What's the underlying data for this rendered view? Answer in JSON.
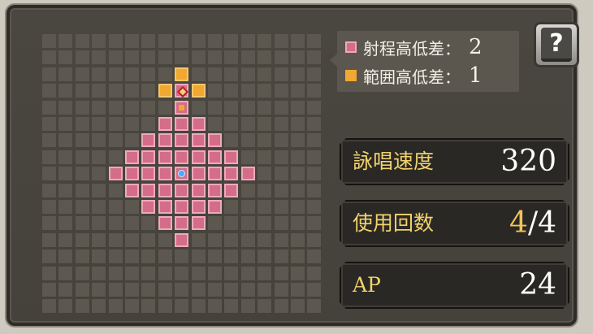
{
  "legend": {
    "range_label": "射程高低差：",
    "range_value": "2",
    "area_label": "範囲高低差：",
    "area_value": "1"
  },
  "help_icon": "help-book-icon",
  "stats": {
    "cast_speed": {
      "label": "詠唱速度",
      "value": "320"
    },
    "uses": {
      "label": "使用回数",
      "current": "4",
      "sep": "/",
      "max": "4"
    },
    "ap": {
      "label": "AP",
      "value": "24"
    }
  },
  "grid": {
    "cols": 17,
    "rows": 17,
    "origin": [
      8,
      8
    ],
    "range_cells": [
      [
        8,
        3
      ],
      [
        8,
        4
      ],
      [
        7,
        5
      ],
      [
        8,
        5
      ],
      [
        9,
        5
      ],
      [
        6,
        6
      ],
      [
        7,
        6
      ],
      [
        8,
        6
      ],
      [
        9,
        6
      ],
      [
        10,
        6
      ],
      [
        5,
        7
      ],
      [
        6,
        7
      ],
      [
        7,
        7
      ],
      [
        8,
        7
      ],
      [
        9,
        7
      ],
      [
        10,
        7
      ],
      [
        11,
        7
      ],
      [
        4,
        8
      ],
      [
        5,
        8
      ],
      [
        6,
        8
      ],
      [
        7,
        8
      ],
      [
        8,
        8
      ],
      [
        9,
        8
      ],
      [
        10,
        8
      ],
      [
        11,
        8
      ],
      [
        12,
        8
      ],
      [
        5,
        9
      ],
      [
        6,
        9
      ],
      [
        7,
        9
      ],
      [
        8,
        9
      ],
      [
        9,
        9
      ],
      [
        10,
        9
      ],
      [
        11,
        9
      ],
      [
        6,
        10
      ],
      [
        7,
        10
      ],
      [
        8,
        10
      ],
      [
        9,
        10
      ],
      [
        10,
        10
      ],
      [
        7,
        11
      ],
      [
        8,
        11
      ],
      [
        9,
        11
      ],
      [
        8,
        12
      ]
    ],
    "area_cells": [
      [
        8,
        2
      ],
      [
        7,
        3
      ],
      [
        9,
        3
      ]
    ],
    "target": [
      8,
      3
    ],
    "area_marker": [
      8,
      4
    ]
  },
  "colors": {
    "range": "#d46d88",
    "area": "#f0a832",
    "label_gold": "#f1d26c",
    "value_gold": "#f0c35e"
  }
}
